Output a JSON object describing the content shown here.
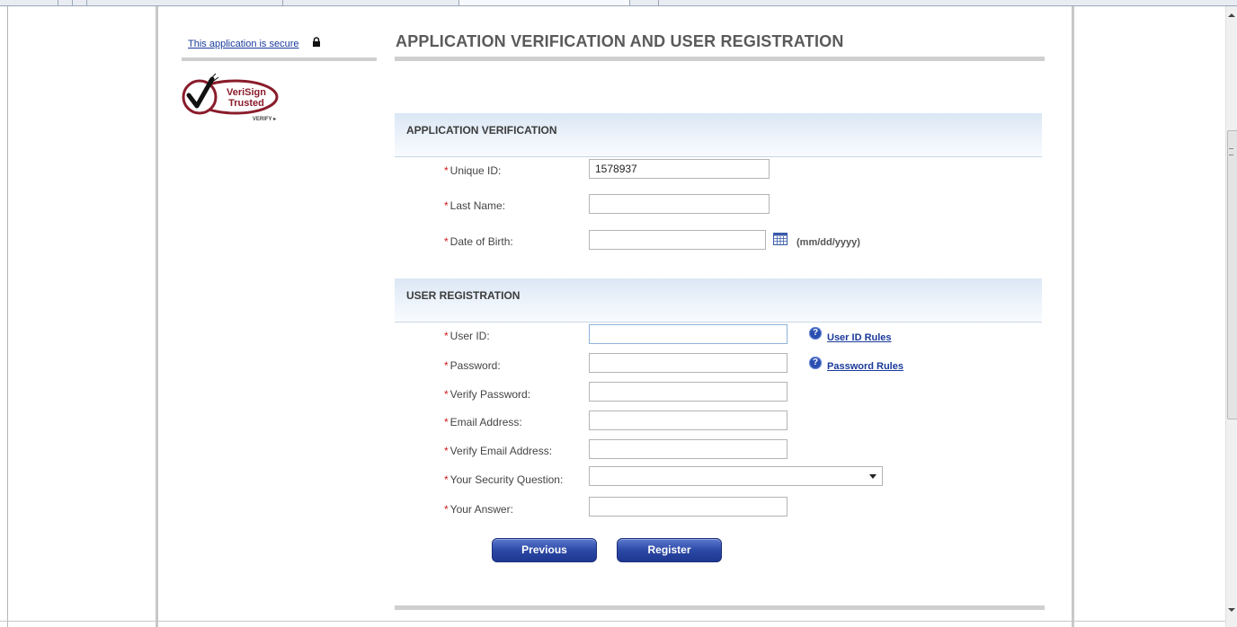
{
  "sidebar": {
    "secure_link": "This application is secure"
  },
  "main": {
    "title": "APPLICATION VERIFICATION AND USER REGISTRATION",
    "verification": {
      "heading": "APPLICATION VERIFICATION",
      "unique_id_label": "Unique ID:",
      "unique_id_value": "1578937",
      "last_name_label": "Last Name:",
      "last_name_value": "",
      "dob_label": "Date of Birth:",
      "dob_value": "",
      "dob_hint": "(mm/dd/yyyy)"
    },
    "registration": {
      "heading": "USER REGISTRATION",
      "user_id_label": "User ID:",
      "user_id_rules": "User ID Rules",
      "password_label": "Password:",
      "password_rules": "Password Rules",
      "verify_password_label": "Verify Password:",
      "email_label": "Email Address:",
      "verify_email_label": "Verify Email Address:",
      "security_question_label": "Your Security Question:",
      "security_question_value": "",
      "answer_label": "Your Answer:"
    },
    "buttons": {
      "previous": "Previous",
      "register": "Register"
    }
  },
  "required_marker": "*",
  "colors": {
    "link": "#1a3a9a",
    "required": "#d21a1a",
    "button": "#2c49a6",
    "section_band": "#dbe7f5"
  }
}
